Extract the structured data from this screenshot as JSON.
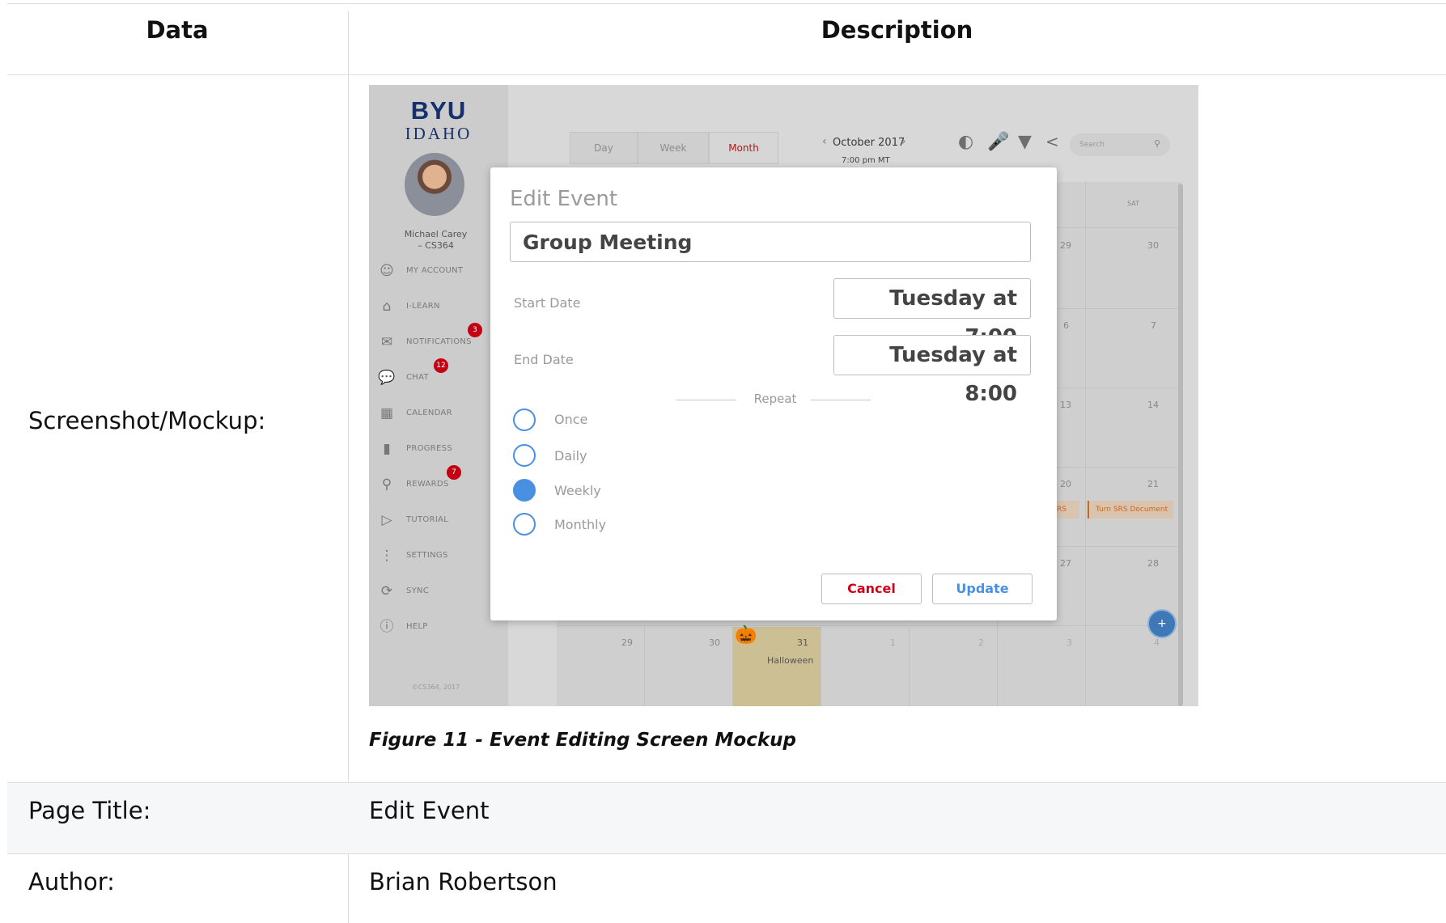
{
  "table": {
    "header": {
      "col1": "Data",
      "col2": "Description"
    },
    "rows": {
      "screenshot_label": "Screenshot/Mockup:",
      "page_title_label": "Page Title:",
      "page_title_value": "Edit Event",
      "author_label": "Author:",
      "author_value": "Brian Robertson"
    },
    "caption": "Figure 11 - Event Editing Screen Mockup"
  },
  "mockup": {
    "logo": {
      "line1": "BYU",
      "line2": "IDAHO"
    },
    "user": {
      "name": "Michael Carey",
      "course": "– CS364"
    },
    "nav": [
      {
        "label": "MY ACCOUNT",
        "icon": "user-icon"
      },
      {
        "label": "I-LEARN",
        "icon": "home-icon"
      },
      {
        "label": "NOTIFICATIONS",
        "icon": "mail-icon",
        "badge": "3"
      },
      {
        "label": "CHAT",
        "icon": "chat-icon",
        "badge": "12"
      },
      {
        "label": "CALENDAR",
        "icon": "calendar-icon"
      },
      {
        "label": "PROGRESS",
        "icon": "bar-chart-icon"
      },
      {
        "label": "REWARDS",
        "icon": "trophy-icon",
        "badge": "7"
      },
      {
        "label": "TUTORIAL",
        "icon": "play-icon"
      },
      {
        "label": "SETTINGS",
        "icon": "sliders-icon"
      },
      {
        "label": "SYNC",
        "icon": "sync-icon"
      },
      {
        "label": "HELP",
        "icon": "help-icon"
      }
    ],
    "copyright": "©CS364, 2017",
    "view_tabs": [
      "Day",
      "Week",
      "Month"
    ],
    "selected_view": "Month",
    "month": "October 2017",
    "time": "7:00 pm MT",
    "search_placeholder": "Search",
    "calendar": {
      "weekday": "SAT",
      "days": [
        "29",
        "30",
        "6",
        "7",
        "13",
        "14",
        "20",
        "21",
        "27",
        "28",
        "29",
        "30",
        "31",
        "1",
        "2",
        "3",
        "4"
      ],
      "events": [
        "RS",
        "Turn SRS Document"
      ],
      "holiday": "Halloween"
    },
    "fab": "+",
    "modal": {
      "title": "Edit Event",
      "event_name": "Group Meeting",
      "start_label": "Start Date",
      "start_value": "Tuesday at 7:00",
      "end_label": "End Date",
      "end_value": "Tuesday at 8:00",
      "repeat_label": "Repeat",
      "repeat_options": [
        "Once",
        "Daily",
        "Weekly",
        "Monthly"
      ],
      "repeat_selected": "Weekly",
      "cancel": "Cancel",
      "update": "Update"
    }
  },
  "colors": {
    "accent": "#4a90e2",
    "cancel": "#d0021b",
    "badge": "#c40012",
    "brand": "#15306a"
  }
}
